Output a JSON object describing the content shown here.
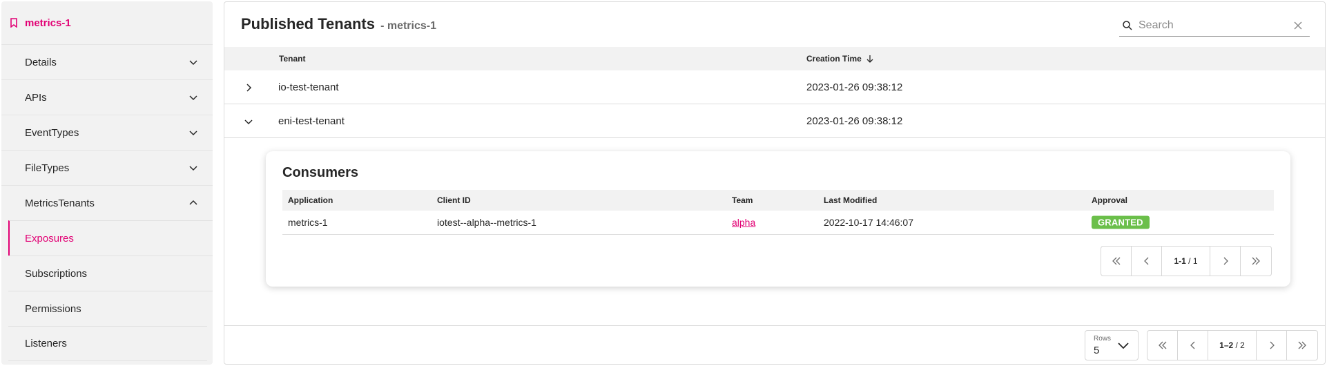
{
  "sidebar": {
    "title": "metrics-1",
    "items": [
      {
        "label": "Details"
      },
      {
        "label": "APIs"
      },
      {
        "label": "EventTypes"
      },
      {
        "label": "FileTypes"
      },
      {
        "label": "MetricsTenants"
      }
    ],
    "subitems": [
      {
        "label": "Exposures"
      },
      {
        "label": "Subscriptions"
      },
      {
        "label": "Permissions"
      },
      {
        "label": "Listeners"
      }
    ]
  },
  "main": {
    "title": "Published Tenants",
    "subtitle": "- metrics-1",
    "search_placeholder": "Search",
    "columns": {
      "tenant": "Tenant",
      "creation_time": "Creation Time"
    },
    "rows": [
      {
        "tenant": "io-test-tenant",
        "creation_time": "2023-01-26 09:38:12"
      },
      {
        "tenant": "eni-test-tenant",
        "creation_time": "2023-01-26 09:38:12"
      }
    ],
    "consumers": {
      "title": "Consumers",
      "columns": {
        "application": "Application",
        "client_id": "Client ID",
        "team": "Team",
        "last_modified": "Last Modified",
        "approval": "Approval"
      },
      "rows": [
        {
          "application": "metrics-1",
          "client_id": "iotest--alpha--metrics-1",
          "team": "alpha",
          "last_modified": "2022-10-17 14:46:07",
          "approval": "GRANTED"
        }
      ],
      "pagination": {
        "range": "1-1",
        "total": "/ 1"
      }
    },
    "footer": {
      "rows_label": "Rows",
      "rows_value": "5",
      "pagination": {
        "range": "1–2",
        "total": "/ 2"
      }
    }
  },
  "colors": {
    "accent": "#e20074",
    "granted": "#6bbf4a"
  }
}
